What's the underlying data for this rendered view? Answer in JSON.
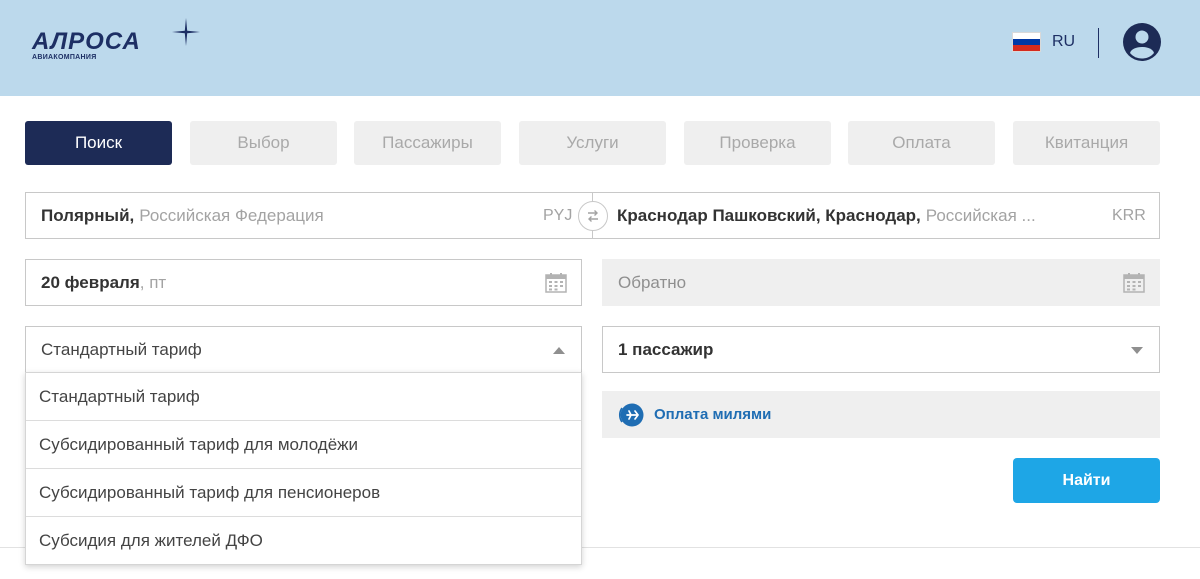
{
  "header": {
    "logo_text": "АЛРОСА",
    "logo_subtitle": "АВИАКОМПАНИЯ",
    "language": "RU",
    "flag_colors": [
      "#ffffff",
      "#0039a6",
      "#d52b1e"
    ]
  },
  "steps": [
    {
      "label": "Поиск",
      "active": true
    },
    {
      "label": "Выбор",
      "active": false
    },
    {
      "label": "Пассажиры",
      "active": false
    },
    {
      "label": "Услуги",
      "active": false
    },
    {
      "label": "Проверка",
      "active": false
    },
    {
      "label": "Оплата",
      "active": false
    },
    {
      "label": "Квитанция",
      "active": false
    }
  ],
  "route": {
    "from_city": "Полярный,",
    "from_country": "Российская Федерация",
    "from_code": "PYJ",
    "to_city": "Краснодар Пашковский, Краснодар,",
    "to_country": "Российская ...",
    "to_code": "KRR"
  },
  "dates": {
    "departure_day": "20 февраля",
    "departure_weekday": ", пт",
    "return_placeholder": "Обратно"
  },
  "fare": {
    "selected": "Стандартный тариф",
    "options": [
      "Стандартный тариф",
      "Субсидированный тариф для молодёжи",
      "Субсидированный тариф для пенсионеров",
      "Субсидия для жителей ДФО"
    ]
  },
  "passengers": {
    "selected": "1 пассажир"
  },
  "miles": {
    "label": "Оплата милями"
  },
  "search": {
    "label": "Найти"
  },
  "colors": {
    "header_bg": "#bcd9ec",
    "brand_navy": "#1d2b56",
    "accent_blue": "#1ea6e6",
    "link_blue": "#1f6db3"
  }
}
